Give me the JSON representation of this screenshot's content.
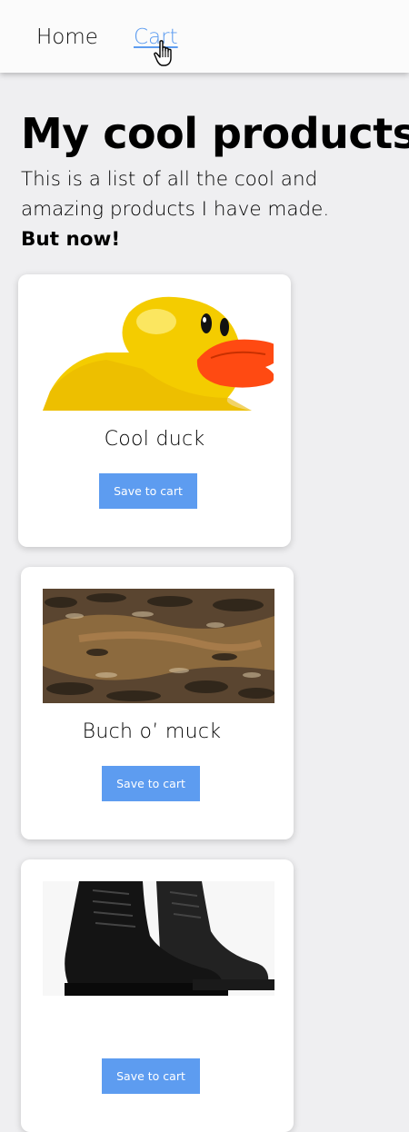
{
  "nav": {
    "home_label": "Home",
    "cart_label": "Cart"
  },
  "header": {
    "title": "My cool products",
    "intro": "This is a list of all the cool and amazing products I have made.",
    "intro_strong": "But now!"
  },
  "products": [
    {
      "name": "Cool duck",
      "button_label": "Save to cart",
      "image": "rubber-duck"
    },
    {
      "name": "Buch o’ muck",
      "button_label": "Save to cart",
      "image": "mud"
    },
    {
      "name": "",
      "button_label": "Save to cart",
      "image": "black-boots"
    }
  ],
  "colors": {
    "accent": "#5d9cf0",
    "page_bg": "#efeff1",
    "nav_bg": "#fbfbfb",
    "card_bg": "#ffffff"
  }
}
